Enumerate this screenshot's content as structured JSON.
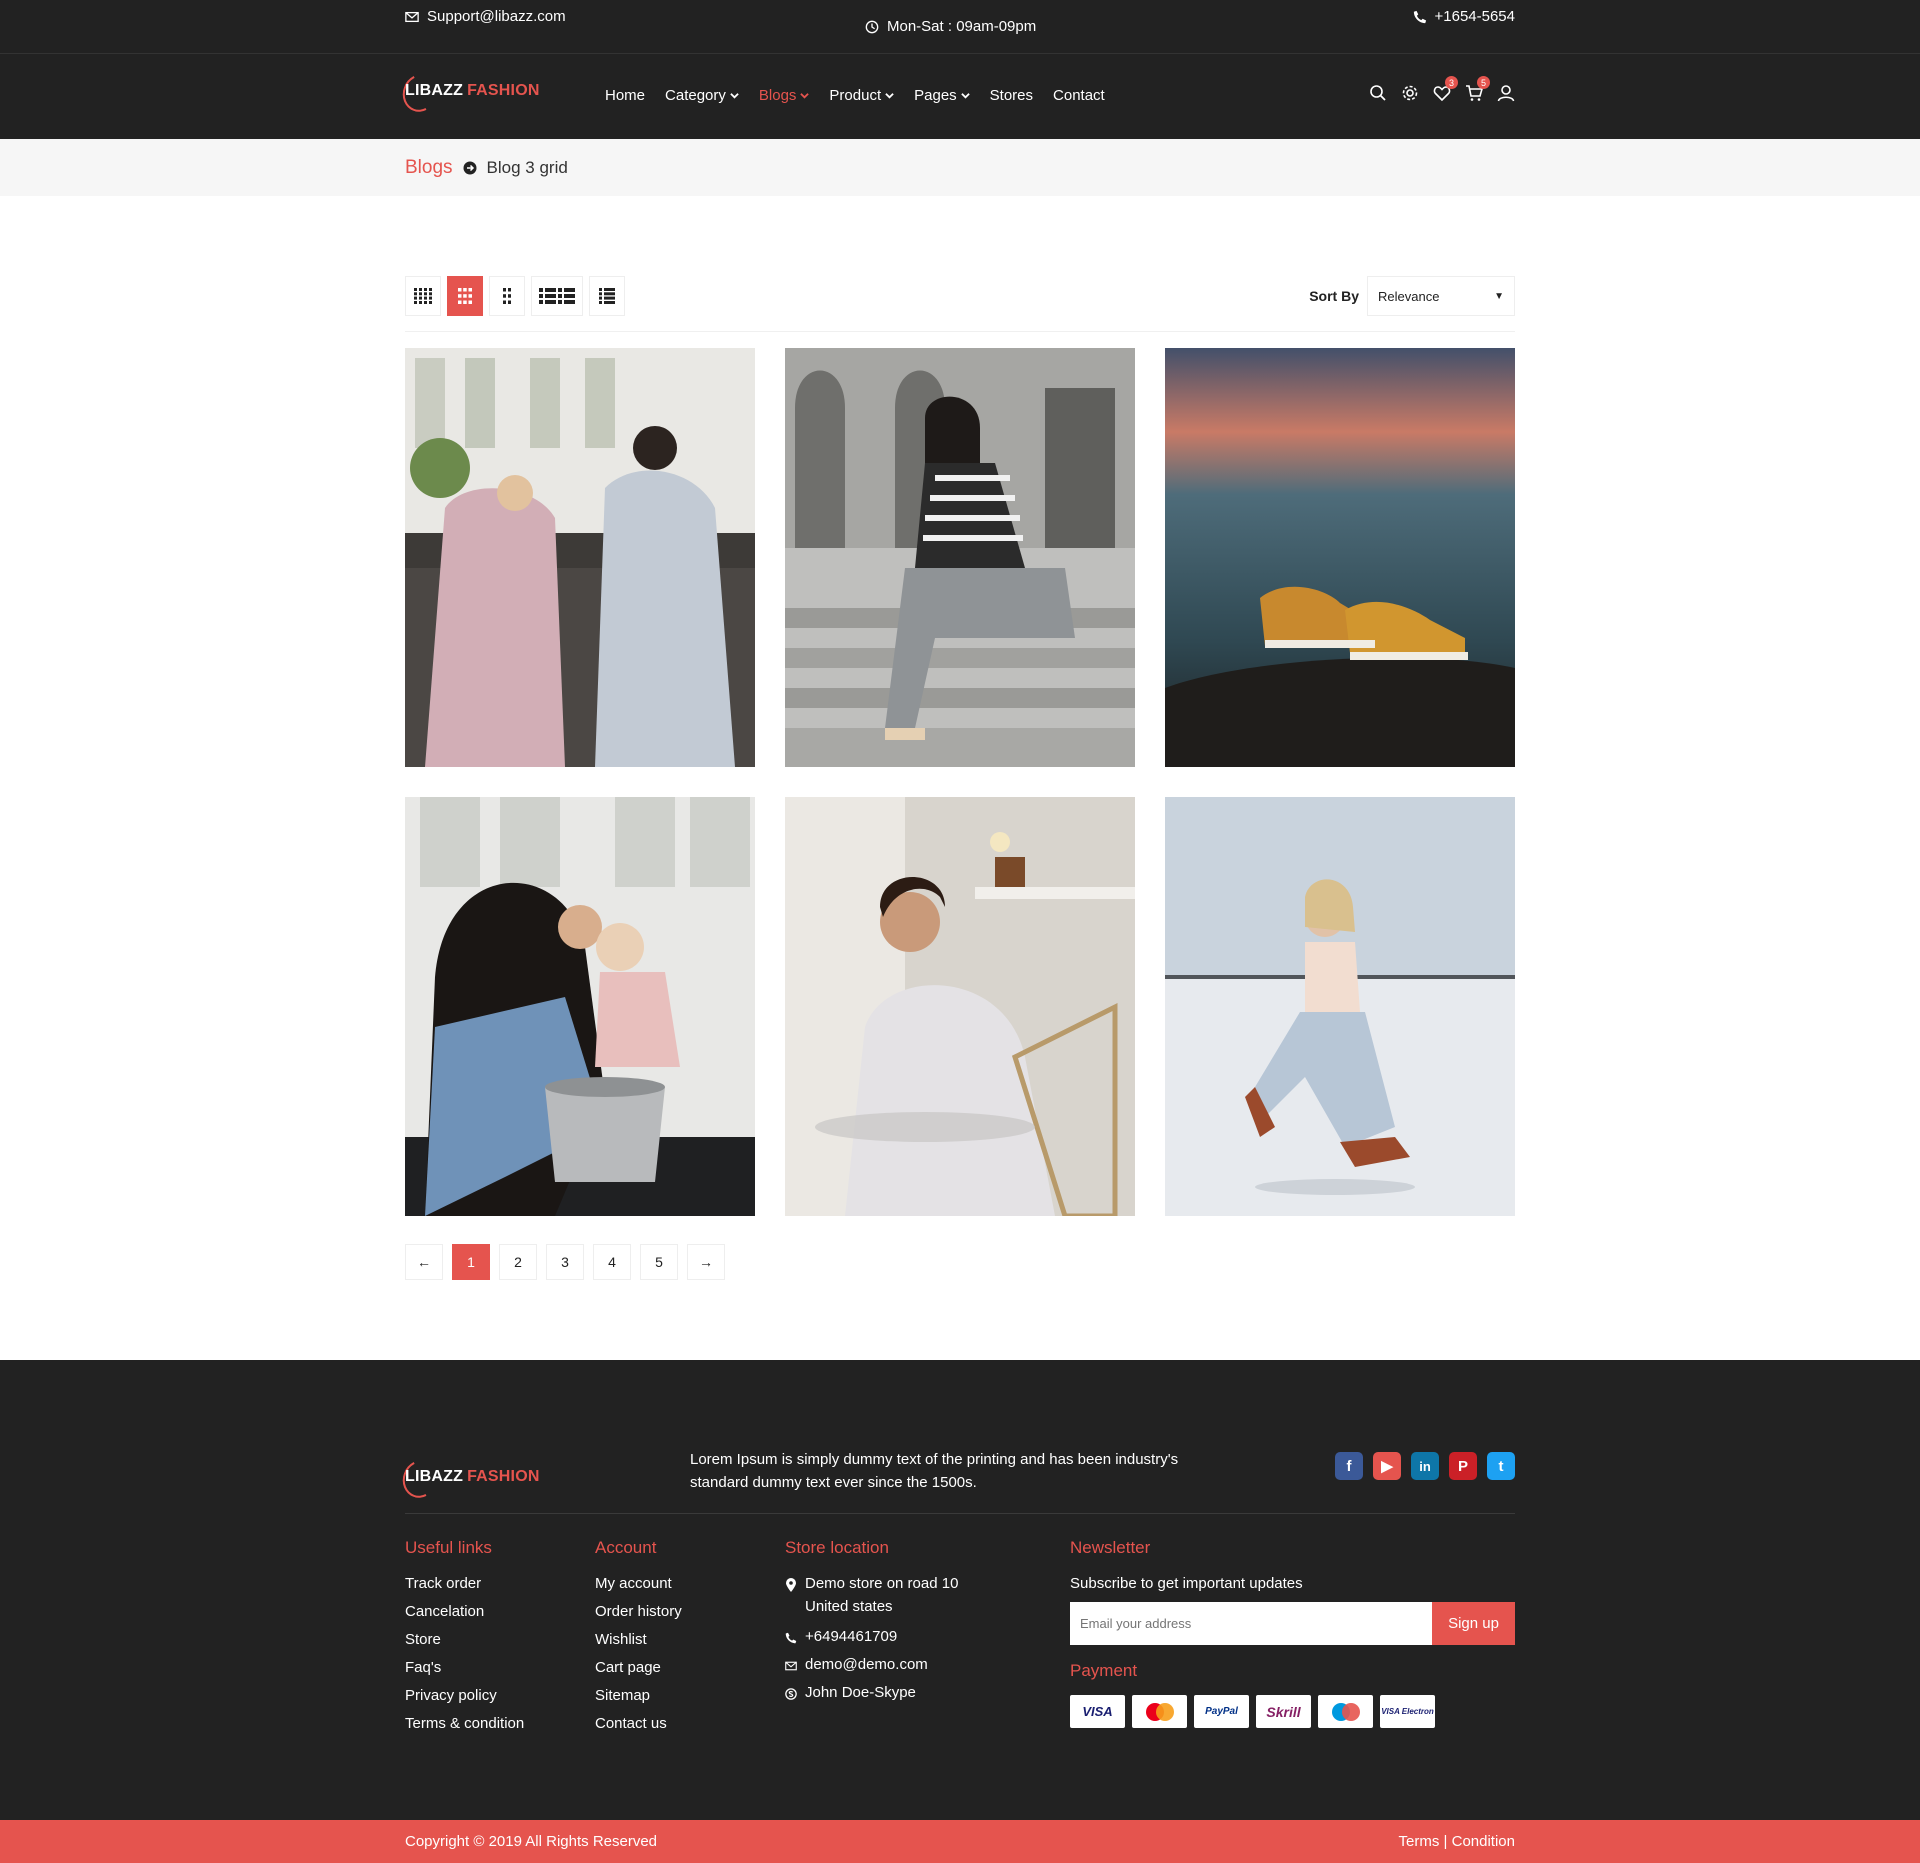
{
  "topbar": {
    "email": "Support@libazz.com",
    "hours": "Mon-Sat : 09am-09pm",
    "phone": "+1654-5654"
  },
  "brand": {
    "part1": "LIBAZZ",
    "part2": "FASHION"
  },
  "nav": {
    "items": [
      {
        "label": "Home",
        "dropdown": false,
        "active": false
      },
      {
        "label": "Category",
        "dropdown": true,
        "active": false
      },
      {
        "label": "Blogs",
        "dropdown": true,
        "active": true
      },
      {
        "label": "Product",
        "dropdown": true,
        "active": false
      },
      {
        "label": "Pages",
        "dropdown": true,
        "active": false
      },
      {
        "label": "Stores",
        "dropdown": false,
        "active": false
      },
      {
        "label": "Contact",
        "dropdown": false,
        "active": false
      }
    ],
    "wishlist_count": "3",
    "cart_count": "5",
    "icons": [
      "search-icon",
      "settings-icon",
      "heart-icon",
      "cart-icon",
      "user-icon"
    ]
  },
  "breadcrumb": {
    "home": "Blogs",
    "current": "Blog 3 grid"
  },
  "toolbar": {
    "sort_label": "Sort By",
    "sort_value": "Relevance",
    "views": [
      "grid-4-icon",
      "grid-3-icon",
      "grid-2-icon",
      "list-wide-icon",
      "list-icon"
    ],
    "active_view": 1
  },
  "posts": [
    {
      "alt": "kids-wrapped-in-blankets"
    },
    {
      "alt": "woman-sitting-on-steps"
    },
    {
      "alt": "sneakers-on-beach-at-sunset"
    },
    {
      "alt": "mother-and-daughter-cooking"
    },
    {
      "alt": "man-leaning-on-table"
    },
    {
      "alt": "woman-kneeling-on-snow"
    }
  ],
  "pagination": {
    "prev": "←",
    "pages": [
      "1",
      "2",
      "3",
      "4",
      "5"
    ],
    "current": "1",
    "next": "→"
  },
  "footer": {
    "description": "Lorem Ipsum is simply dummy text of the printing and has been industry's standard dummy text ever since the 1500s.",
    "social": [
      "facebook-icon",
      "youtube-icon",
      "linkedin-icon",
      "pinterest-icon",
      "twitter-icon"
    ],
    "useful": {
      "title": "Useful links",
      "links": [
        "Track order",
        "Cancelation",
        "Store",
        "Faq's",
        "Privacy policy",
        "Terms & condition"
      ]
    },
    "account": {
      "title": "Account",
      "links": [
        "My account",
        "Order history",
        "Wishlist",
        "Cart page",
        "Sitemap",
        "Contact us"
      ]
    },
    "store": {
      "title": "Store location",
      "address": "Demo store on road 10 United states",
      "phone": "+6494461709",
      "email": "demo@demo.com",
      "skype": "John Doe-Skype"
    },
    "newsletter": {
      "title": "Newsletter",
      "subtitle": "Subscribe to get important updates",
      "placeholder": "Email your address",
      "button": "Sign up"
    },
    "payment": {
      "title": "Payment",
      "cards": [
        "VISA",
        "MasterCard",
        "PayPal",
        "Skrill",
        "Maestro",
        "VISA Electron"
      ]
    }
  },
  "bottombar": {
    "copyright": "Copyright © 2019 All Rights Reserved",
    "terms": "Terms | Condition"
  },
  "colors": {
    "accent": "#e5544e",
    "dark": "#222222"
  }
}
